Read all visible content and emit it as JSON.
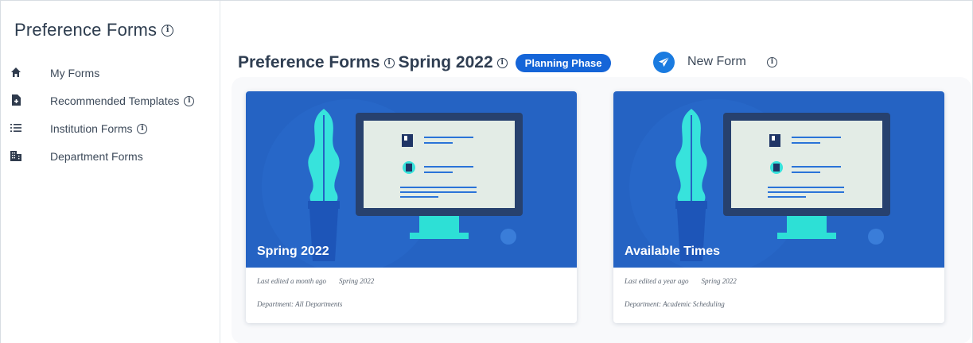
{
  "sidebar": {
    "title": "Preference Forms",
    "items": [
      {
        "label": "My Forms",
        "icon": "home-icon"
      },
      {
        "label": "Recommended Templates",
        "icon": "file-plus-icon",
        "info": true
      },
      {
        "label": "Institution Forms",
        "icon": "list-icon",
        "info": true
      },
      {
        "label": "Department Forms",
        "icon": "building-icon"
      }
    ]
  },
  "header": {
    "title": "Preference Forms",
    "term": "Spring 2022",
    "phase_badge": "Planning Phase",
    "new_form_label": "New Form"
  },
  "cards": [
    {
      "title": "Spring 2022",
      "last_edited": "Last edited a month ago",
      "term": "Spring 2022",
      "department": "Department: All Departments"
    },
    {
      "title": "Available Times",
      "last_edited": "Last edited a year ago",
      "term": "Spring 2022",
      "department": "Department: Academic Scheduling"
    }
  ],
  "colors": {
    "accent": "#1565d8",
    "card_banner": "#2563c3",
    "plant": "#37e3dc",
    "monitor_frame": "#27416e",
    "screen": "#e3ece6"
  }
}
